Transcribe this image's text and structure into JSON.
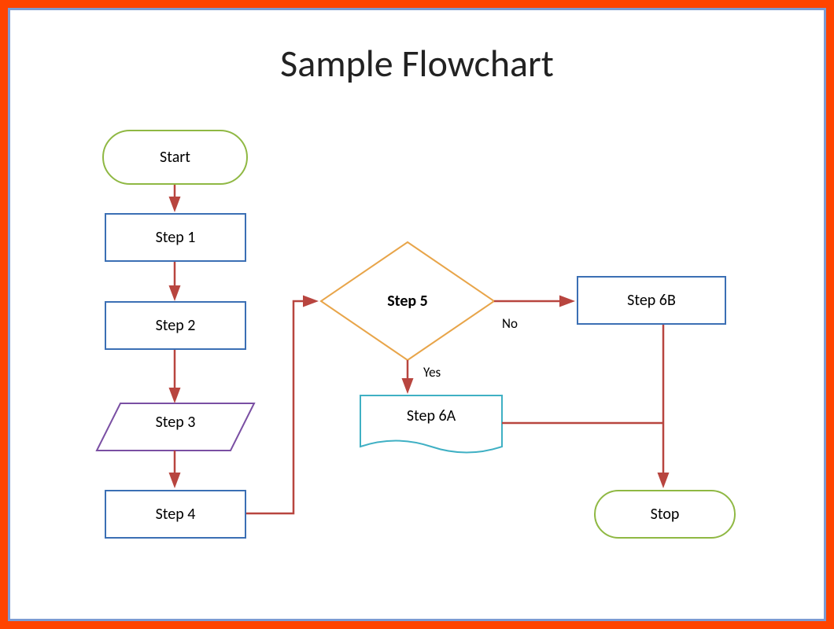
{
  "title": "Sample Flowchart",
  "nodes": {
    "start": "Start",
    "step1": "Step 1",
    "step2": "Step 2",
    "step3": "Step 3",
    "step4": "Step 4",
    "step5": "Step 5",
    "step6a": "Step 6A",
    "step6b": "Step 6B",
    "stop": "Stop"
  },
  "branches": {
    "yes": "Yes",
    "no": "No"
  },
  "colors": {
    "outer_border": "#ff4400",
    "inner_border": "#7b9cd4",
    "terminator_border": "#8fb843",
    "rect_border": "#3b6fb4",
    "parallelogram_border": "#7a4fa3",
    "diamond_border": "#e8a54a",
    "document_border": "#3fb0c4",
    "arrow": "#b8453f"
  }
}
